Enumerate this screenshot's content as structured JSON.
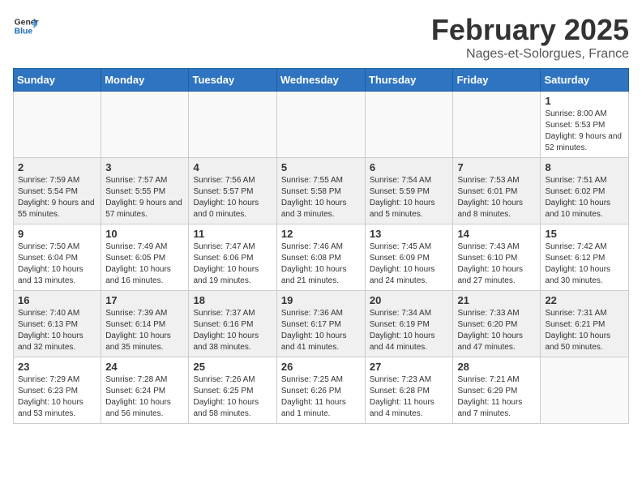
{
  "header": {
    "logo_general": "General",
    "logo_blue": "Blue",
    "month_title": "February 2025",
    "location": "Nages-et-Solorgues, France"
  },
  "days_of_week": [
    "Sunday",
    "Monday",
    "Tuesday",
    "Wednesday",
    "Thursday",
    "Friday",
    "Saturday"
  ],
  "weeks": [
    {
      "row": 1,
      "cells": [
        {
          "day": "",
          "content": ""
        },
        {
          "day": "",
          "content": ""
        },
        {
          "day": "",
          "content": ""
        },
        {
          "day": "",
          "content": ""
        },
        {
          "day": "",
          "content": ""
        },
        {
          "day": "",
          "content": ""
        },
        {
          "day": "1",
          "content": "Sunrise: 8:00 AM\nSunset: 5:53 PM\nDaylight: 9 hours and 52 minutes."
        }
      ]
    },
    {
      "row": 2,
      "cells": [
        {
          "day": "2",
          "content": "Sunrise: 7:59 AM\nSunset: 5:54 PM\nDaylight: 9 hours and 55 minutes."
        },
        {
          "day": "3",
          "content": "Sunrise: 7:57 AM\nSunset: 5:55 PM\nDaylight: 9 hours and 57 minutes."
        },
        {
          "day": "4",
          "content": "Sunrise: 7:56 AM\nSunset: 5:57 PM\nDaylight: 10 hours and 0 minutes."
        },
        {
          "day": "5",
          "content": "Sunrise: 7:55 AM\nSunset: 5:58 PM\nDaylight: 10 hours and 3 minutes."
        },
        {
          "day": "6",
          "content": "Sunrise: 7:54 AM\nSunset: 5:59 PM\nDaylight: 10 hours and 5 minutes."
        },
        {
          "day": "7",
          "content": "Sunrise: 7:53 AM\nSunset: 6:01 PM\nDaylight: 10 hours and 8 minutes."
        },
        {
          "day": "8",
          "content": "Sunrise: 7:51 AM\nSunset: 6:02 PM\nDaylight: 10 hours and 10 minutes."
        }
      ]
    },
    {
      "row": 3,
      "cells": [
        {
          "day": "9",
          "content": "Sunrise: 7:50 AM\nSunset: 6:04 PM\nDaylight: 10 hours and 13 minutes."
        },
        {
          "day": "10",
          "content": "Sunrise: 7:49 AM\nSunset: 6:05 PM\nDaylight: 10 hours and 16 minutes."
        },
        {
          "day": "11",
          "content": "Sunrise: 7:47 AM\nSunset: 6:06 PM\nDaylight: 10 hours and 19 minutes."
        },
        {
          "day": "12",
          "content": "Sunrise: 7:46 AM\nSunset: 6:08 PM\nDaylight: 10 hours and 21 minutes."
        },
        {
          "day": "13",
          "content": "Sunrise: 7:45 AM\nSunset: 6:09 PM\nDaylight: 10 hours and 24 minutes."
        },
        {
          "day": "14",
          "content": "Sunrise: 7:43 AM\nSunset: 6:10 PM\nDaylight: 10 hours and 27 minutes."
        },
        {
          "day": "15",
          "content": "Sunrise: 7:42 AM\nSunset: 6:12 PM\nDaylight: 10 hours and 30 minutes."
        }
      ]
    },
    {
      "row": 4,
      "cells": [
        {
          "day": "16",
          "content": "Sunrise: 7:40 AM\nSunset: 6:13 PM\nDaylight: 10 hours and 32 minutes."
        },
        {
          "day": "17",
          "content": "Sunrise: 7:39 AM\nSunset: 6:14 PM\nDaylight: 10 hours and 35 minutes."
        },
        {
          "day": "18",
          "content": "Sunrise: 7:37 AM\nSunset: 6:16 PM\nDaylight: 10 hours and 38 minutes."
        },
        {
          "day": "19",
          "content": "Sunrise: 7:36 AM\nSunset: 6:17 PM\nDaylight: 10 hours and 41 minutes."
        },
        {
          "day": "20",
          "content": "Sunrise: 7:34 AM\nSunset: 6:19 PM\nDaylight: 10 hours and 44 minutes."
        },
        {
          "day": "21",
          "content": "Sunrise: 7:33 AM\nSunset: 6:20 PM\nDaylight: 10 hours and 47 minutes."
        },
        {
          "day": "22",
          "content": "Sunrise: 7:31 AM\nSunset: 6:21 PM\nDaylight: 10 hours and 50 minutes."
        }
      ]
    },
    {
      "row": 5,
      "cells": [
        {
          "day": "23",
          "content": "Sunrise: 7:29 AM\nSunset: 6:23 PM\nDaylight: 10 hours and 53 minutes."
        },
        {
          "day": "24",
          "content": "Sunrise: 7:28 AM\nSunset: 6:24 PM\nDaylight: 10 hours and 56 minutes."
        },
        {
          "day": "25",
          "content": "Sunrise: 7:26 AM\nSunset: 6:25 PM\nDaylight: 10 hours and 58 minutes."
        },
        {
          "day": "26",
          "content": "Sunrise: 7:25 AM\nSunset: 6:26 PM\nDaylight: 11 hours and 1 minute."
        },
        {
          "day": "27",
          "content": "Sunrise: 7:23 AM\nSunset: 6:28 PM\nDaylight: 11 hours and 4 minutes."
        },
        {
          "day": "28",
          "content": "Sunrise: 7:21 AM\nSunset: 6:29 PM\nDaylight: 11 hours and 7 minutes."
        },
        {
          "day": "",
          "content": ""
        }
      ]
    }
  ]
}
